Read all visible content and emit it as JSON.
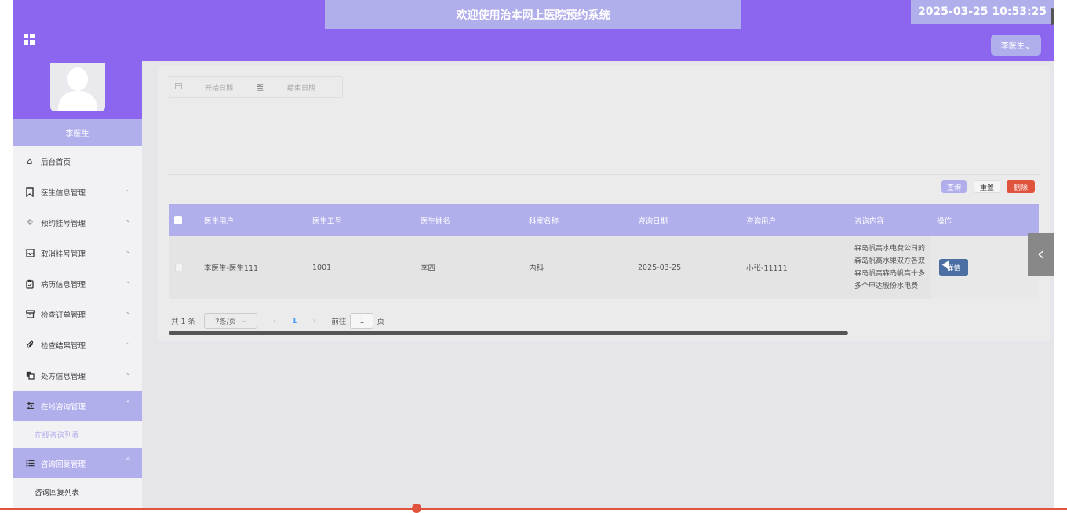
{
  "header": {
    "title": "欢迎使用治本网上医院预约系统",
    "datetime": "2025-03-25 10:53:25",
    "user_menu": "李医生⌄"
  },
  "sidebar": {
    "user_name": "李医生",
    "items": [
      {
        "label": "后台首页",
        "icon": "home-icon"
      },
      {
        "label": "医生信息管理",
        "icon": "bookmark-icon"
      },
      {
        "label": "预约挂号管理",
        "icon": "sun-icon"
      },
      {
        "label": "取消挂号管理",
        "icon": "inbox-icon"
      },
      {
        "label": "病历信息管理",
        "icon": "clipboard-icon"
      },
      {
        "label": "检查订单管理",
        "icon": "archive-icon"
      },
      {
        "label": "检查结果管理",
        "icon": "paperclip-icon"
      },
      {
        "label": "处方信息管理",
        "icon": "copy-icon"
      },
      {
        "label": "在线咨询管理",
        "icon": "sliders-icon"
      },
      {
        "label": "咨询回复管理",
        "icon": "list-icon"
      }
    ],
    "sub_consult": "在线咨询列表",
    "sub_reply": "咨询回复列表"
  },
  "filter": {
    "start_placeholder": "开始日期",
    "separator": "至",
    "end_placeholder": "结束日期"
  },
  "actions": {
    "query": "查询",
    "reset": "重置",
    "delete": "删除"
  },
  "table": {
    "columns": [
      "医生用户",
      "医生工号",
      "医生姓名",
      "科室名称",
      "咨询日期",
      "咨询用户",
      "咨询内容",
      "操作"
    ],
    "rows": [
      {
        "doctor_user": "李医生-医生111",
        "doctor_no": "1001",
        "doctor_name": "李四",
        "department": "内科",
        "date": "2025-03-25",
        "consult_user": "小张-11111",
        "content_lines": [
          "森岛帆高水电费公司的",
          "森岛帆高水果双方各双",
          "森岛帆高森岛帆高十多",
          "多个申达股份水电费"
        ],
        "action": "详情"
      }
    ]
  },
  "pagination": {
    "total": "共 1 条",
    "page_size": "7条/页",
    "current_page": "1",
    "goto_label": "前往",
    "goto_value": "1",
    "page_word": "页"
  },
  "colors": {
    "header": "#8d66ef",
    "accent": "#b1aeec",
    "danger": "#e0533d",
    "detail_button": "#4b6fa3"
  }
}
